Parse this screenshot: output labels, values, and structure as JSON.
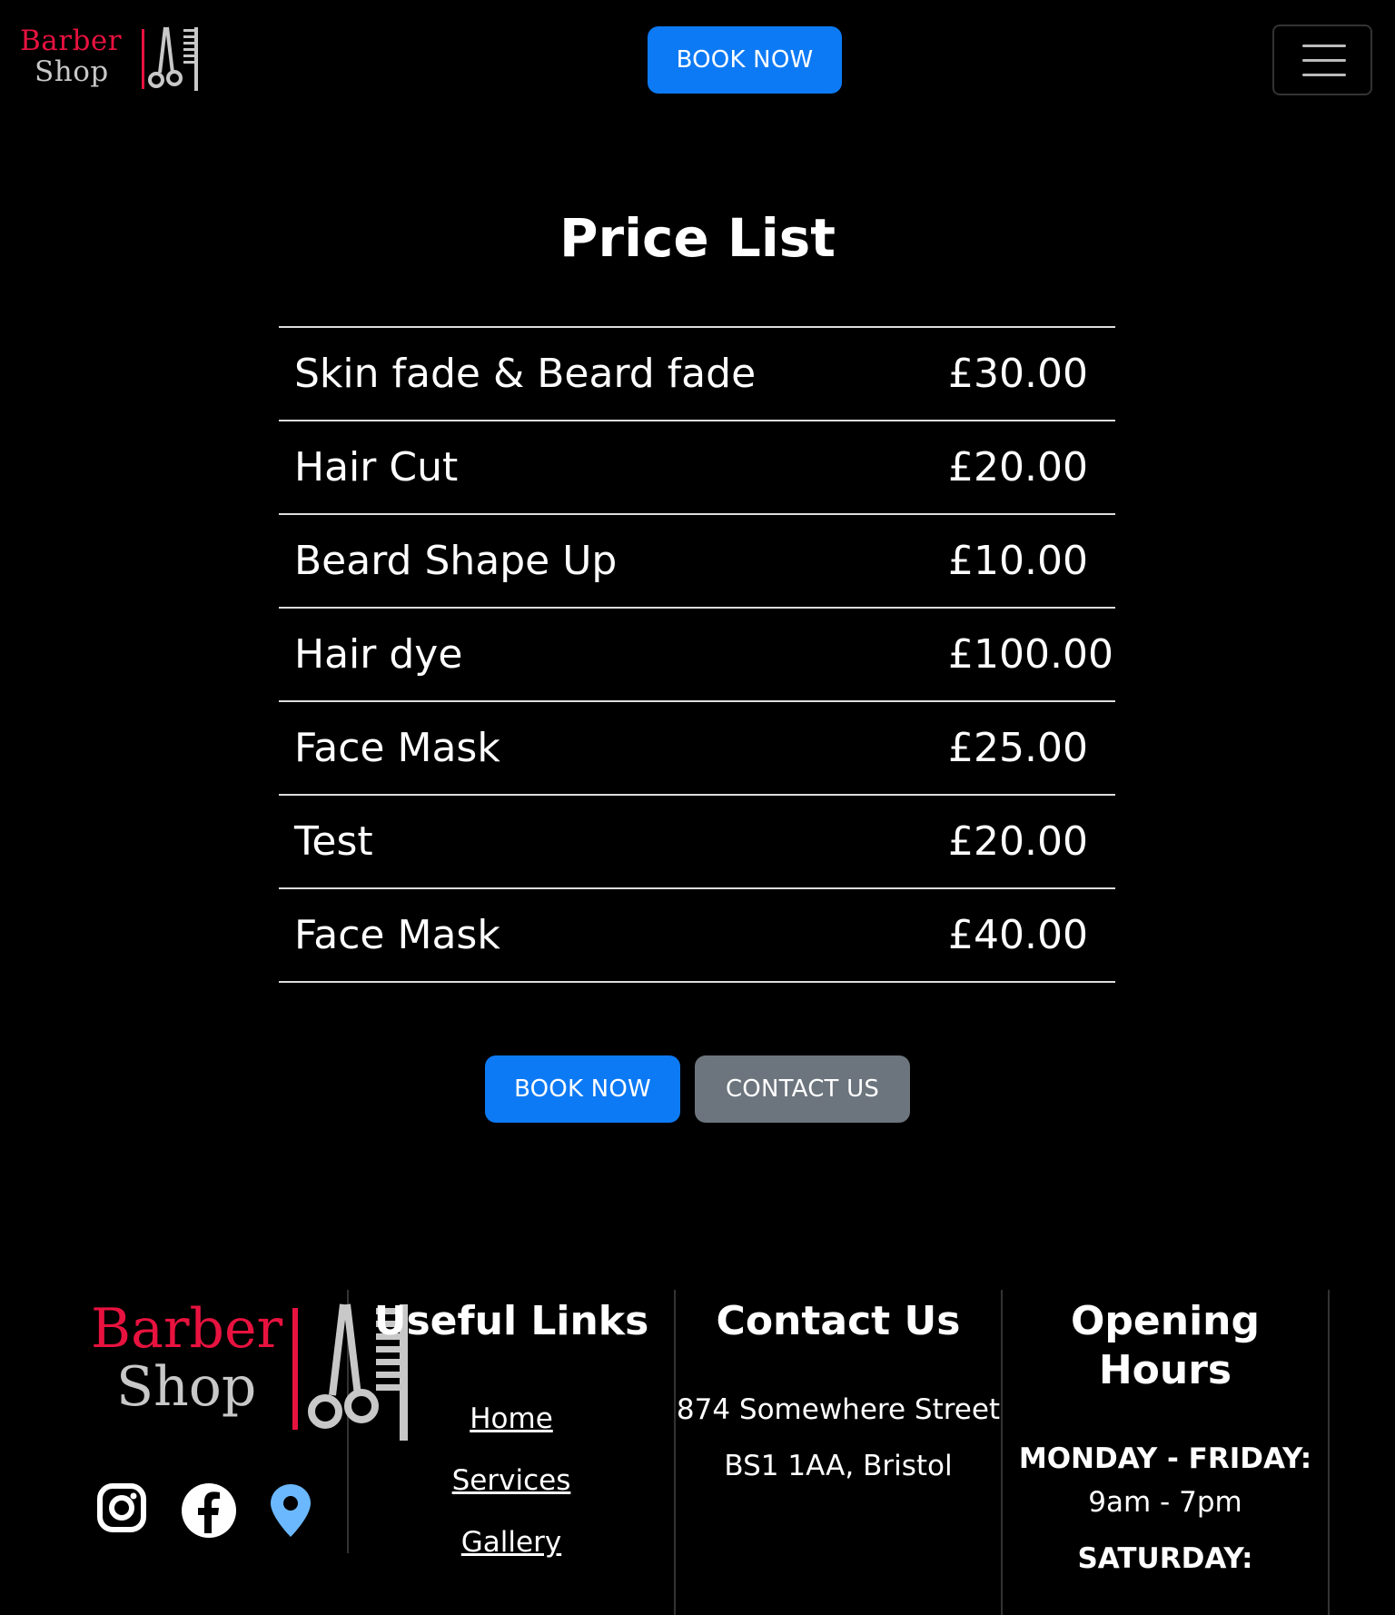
{
  "brand": {
    "line1": "Barber",
    "line2": "Shop",
    "colors": {
      "accent": "#e8123f",
      "muted": "#c8c8c8"
    }
  },
  "header": {
    "book_label": "BOOK NOW",
    "menu_icon": "hamburger-icon"
  },
  "price_list": {
    "title": "Price List",
    "items": [
      {
        "name": "Skin fade & Beard fade",
        "price": "£30.00"
      },
      {
        "name": "Hair Cut",
        "price": "£20.00"
      },
      {
        "name": "Beard Shape Up",
        "price": "£10.00"
      },
      {
        "name": "Hair dye",
        "price": "£100.00"
      },
      {
        "name": "Face Mask",
        "price": "£25.00"
      },
      {
        "name": "Test",
        "price": "£20.00"
      },
      {
        "name": "Face Mask",
        "price": "£40.00"
      }
    ]
  },
  "actions": {
    "book_label": "BOOK NOW",
    "contact_label": "CONTACT US"
  },
  "footer": {
    "social": [
      "instagram-icon",
      "facebook-icon",
      "map-pin-icon"
    ],
    "links": {
      "title": "Useful Links",
      "items": [
        "Home",
        "Services",
        "Gallery"
      ]
    },
    "contact": {
      "title": "Contact Us",
      "address_line1": "874 Somewhere Street",
      "address_line2": "BS1 1AA, Bristol"
    },
    "hours": {
      "title": "Opening Hours",
      "weekday_label": "MONDAY - FRIDAY:",
      "weekday_time": "9am - 7pm",
      "saturday_label": "SATURDAY:"
    }
  },
  "colors": {
    "primary": "#0d7af5",
    "secondary": "#6c757d",
    "background": "#000000",
    "map_pin": "#6bb8ff"
  }
}
